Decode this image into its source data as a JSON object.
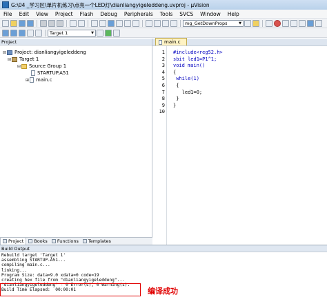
{
  "window": {
    "title": "G:\\04 _学习区\\单片机练习\\点亮一个LED灯\\dianliangyigeleddeng.uvproj - µVision"
  },
  "menu": [
    "File",
    "Edit",
    "View",
    "Project",
    "Flash",
    "Debug",
    "Peripherals",
    "Tools",
    "SVCS",
    "Window",
    "Help"
  ],
  "toolbar": {
    "find_value": "mg_GetDownProps",
    "target_value": "Target 1"
  },
  "project_panel": {
    "header": "Project",
    "tree": [
      {
        "label": "Project: dianliangyigeleddeng",
        "icon": "project-icon",
        "expander": "⊟"
      },
      {
        "label": "Target 1",
        "icon": "target-icon",
        "expander": "⊟"
      },
      {
        "label": "Source Group 1",
        "icon": "folder-icon",
        "expander": "⊟"
      },
      {
        "label": "STARTUP.A51",
        "icon": "file-icon",
        "expander": ""
      },
      {
        "label": "main.c",
        "icon": "file-icon",
        "expander": "⊞"
      }
    ],
    "tabs": [
      "Project",
      "Books",
      "Functions",
      "Templates"
    ]
  },
  "editor": {
    "tab": "main.c",
    "lines": [
      {
        "n": "1",
        "code": "#include<reg52.h>"
      },
      {
        "n": "2",
        "code": "sbit led1=P1^1;"
      },
      {
        "n": "3",
        "code": "void main()"
      },
      {
        "n": "4",
        "code": "{"
      },
      {
        "n": "5",
        "code": " while(1)"
      },
      {
        "n": "6",
        "code": " {"
      },
      {
        "n": "7",
        "code": "   led1=0;"
      },
      {
        "n": "8",
        "code": " }"
      },
      {
        "n": "9",
        "code": "}"
      },
      {
        "n": "10",
        "code": ""
      }
    ]
  },
  "build_output": {
    "header": "Build Output",
    "lines": [
      "Rebuild target 'Target 1'",
      "assembling STARTUP.A51...",
      "compiling main.c...",
      "linking...",
      "Program Size: data=9.0 xdata=0 code=19",
      "creating hex file from \"dianliangyigeleddeng\"...",
      "\"dianliangyigeleddeng\" - 0 Error(s), 0 Warning(s).",
      "Build Time Elapsed:  00:00:01"
    ],
    "annotation": "编译成功"
  },
  "colors": {
    "annotation": "#e00000",
    "keyword": "#0000c0",
    "active_tab": "#fff3c4"
  }
}
